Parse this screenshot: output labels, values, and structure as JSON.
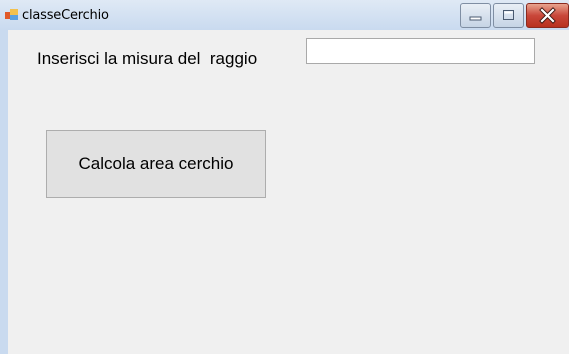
{
  "window": {
    "title": "classeCerchio",
    "icon": "winforms-app-icon",
    "controls": {
      "minimize_icon": "minimize-icon",
      "maximize_icon": "maximize-icon",
      "close_icon": "close-icon"
    }
  },
  "form": {
    "radius_label": "Inserisci la misura del  raggio",
    "radius_input": {
      "value": "",
      "placeholder": ""
    },
    "calculate_button_label": "Calcola area cerchio"
  },
  "colors": {
    "titlebar": "#c9daef",
    "form_background": "#f0f0f0",
    "close_button": "#c9473a"
  }
}
